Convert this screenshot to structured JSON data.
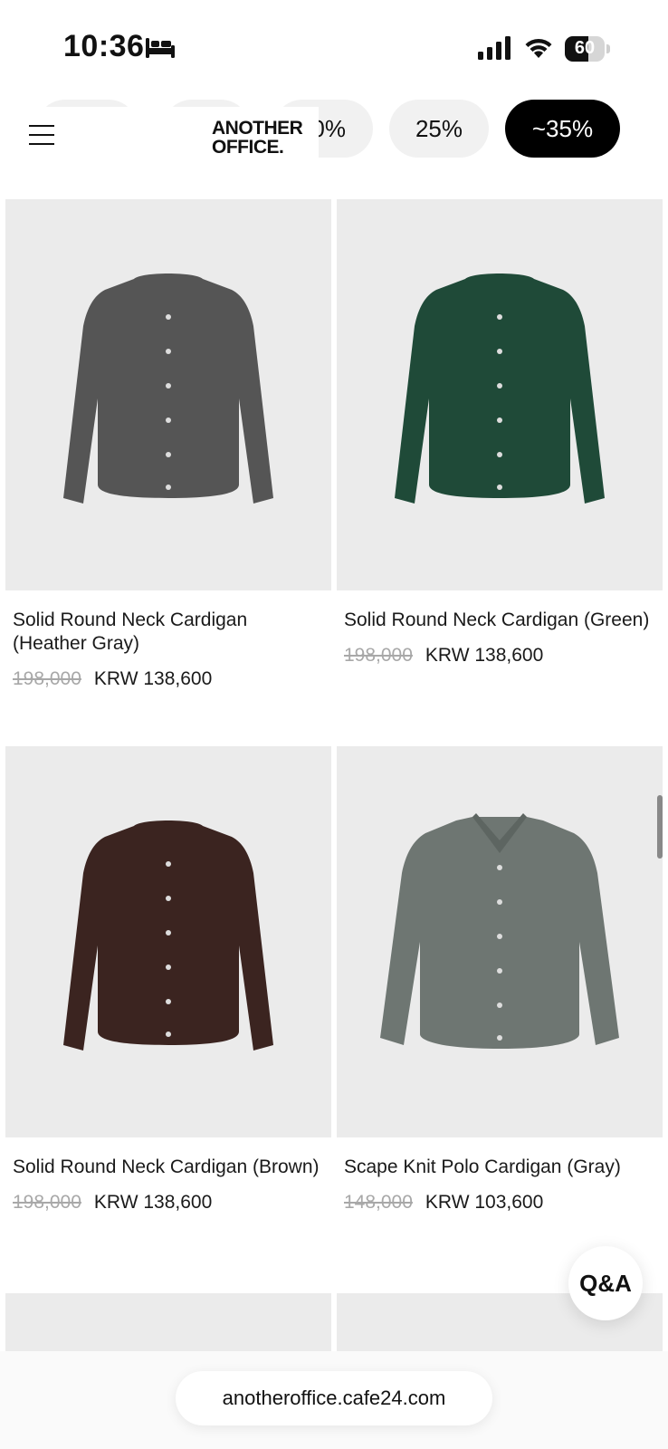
{
  "status": {
    "time": "10:36",
    "battery": "60",
    "battery_level": 0.6
  },
  "header": {
    "logo_line1": "ANOTHER",
    "logo_line2": "OFFICE.",
    "filters": [
      {
        "label": ""
      },
      {
        "label": ""
      },
      {
        "label": "0%"
      },
      {
        "label": "25%"
      },
      {
        "label": "~35%",
        "active": true
      }
    ]
  },
  "products": [
    {
      "name": "Solid Round Neck Cardigan (Heather Gray)",
      "old_price": "198,000",
      "price": "KRW 138,600",
      "color": "#555555"
    },
    {
      "name": "Solid Round Neck Cardigan (Green)",
      "old_price": "198,000",
      "price": "KRW 138,600",
      "color": "#1f4a38"
    },
    {
      "name": "Solid Round Neck Cardigan (Brown)",
      "old_price": "198,000",
      "price": "KRW 138,600",
      "color": "#3b2420"
    },
    {
      "name": "Scape Knit Polo Cardigan (Gray)",
      "old_price": "148,000",
      "price": "KRW 103,600",
      "color": "#6e7672"
    }
  ],
  "qa_button": "Q&A",
  "url": "anotheroffice.cafe24.com"
}
